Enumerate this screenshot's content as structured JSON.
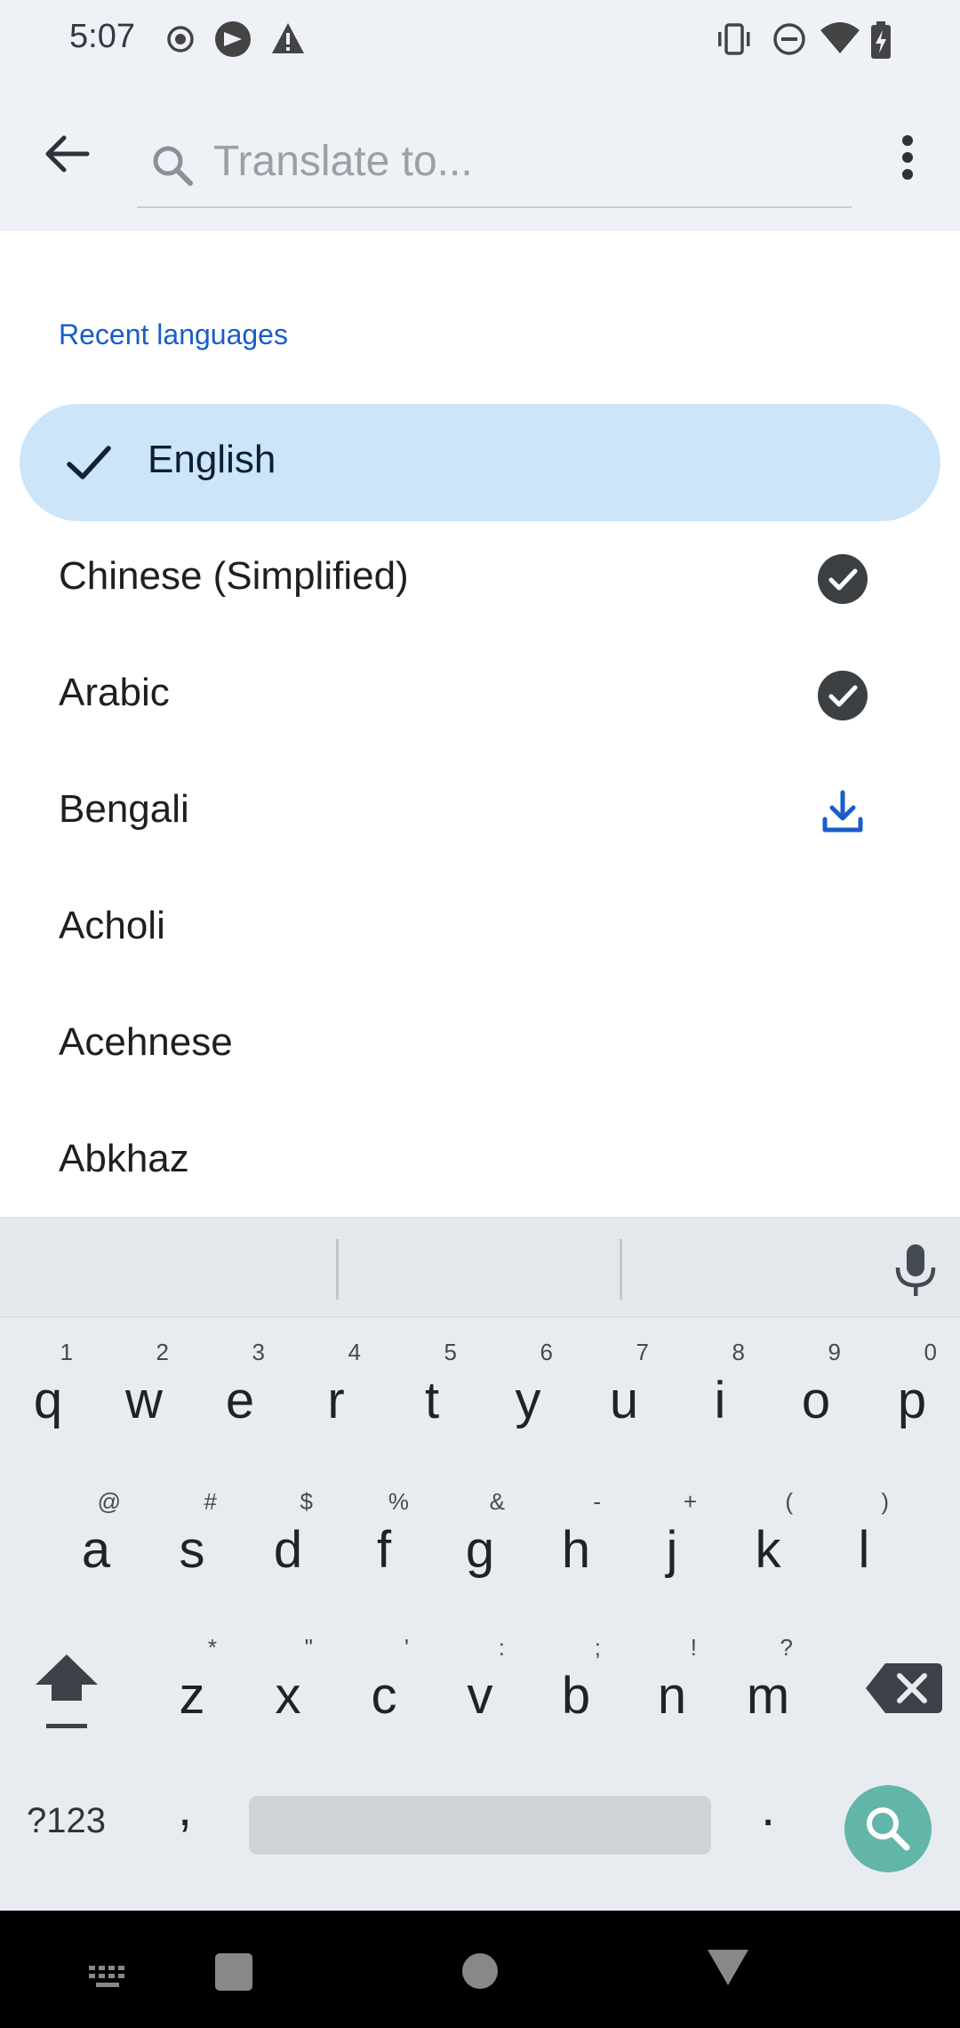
{
  "status_bar": {
    "time": "5:07"
  },
  "search": {
    "placeholder": "Translate to..."
  },
  "recent_section_title": "Recent languages",
  "languages": [
    {
      "label": "English",
      "selected": true,
      "action": "none"
    },
    {
      "label": "Chinese (Simplified)",
      "selected": false,
      "action": "downloaded"
    },
    {
      "label": "Arabic",
      "selected": false,
      "action": "downloaded"
    },
    {
      "label": "Bengali",
      "selected": false,
      "action": "download"
    },
    {
      "label": "Acholi",
      "selected": false,
      "action": "none"
    },
    {
      "label": "Acehnese",
      "selected": false,
      "action": "none"
    },
    {
      "label": "Abkhaz",
      "selected": false,
      "action": "none"
    }
  ],
  "keyboard": {
    "row1": [
      {
        "k": "q",
        "h": "1"
      },
      {
        "k": "w",
        "h": "2"
      },
      {
        "k": "e",
        "h": "3"
      },
      {
        "k": "r",
        "h": "4"
      },
      {
        "k": "t",
        "h": "5"
      },
      {
        "k": "y",
        "h": "6"
      },
      {
        "k": "u",
        "h": "7"
      },
      {
        "k": "i",
        "h": "8"
      },
      {
        "k": "o",
        "h": "9"
      },
      {
        "k": "p",
        "h": "0"
      }
    ],
    "row2": [
      {
        "k": "a",
        "h": "@"
      },
      {
        "k": "s",
        "h": "#"
      },
      {
        "k": "d",
        "h": "$"
      },
      {
        "k": "f",
        "h": "%"
      },
      {
        "k": "g",
        "h": "&"
      },
      {
        "k": "h",
        "h": "-"
      },
      {
        "k": "j",
        "h": "+"
      },
      {
        "k": "k",
        "h": "("
      },
      {
        "k": "l",
        "h": ")"
      }
    ],
    "row3": [
      {
        "k": "z",
        "h": "*"
      },
      {
        "k": "x",
        "h": "\""
      },
      {
        "k": "c",
        "h": "'"
      },
      {
        "k": "v",
        "h": ":"
      },
      {
        "k": "b",
        "h": ";"
      },
      {
        "k": "n",
        "h": "!"
      },
      {
        "k": "m",
        "h": "?"
      }
    ],
    "symbols_label": "?123",
    "comma": ",",
    "period": "."
  },
  "colors": {
    "accent_blue": "#1a5dc8",
    "selected_row_bg": "#cde5f9",
    "keyboard_action": "#62b6a9"
  }
}
